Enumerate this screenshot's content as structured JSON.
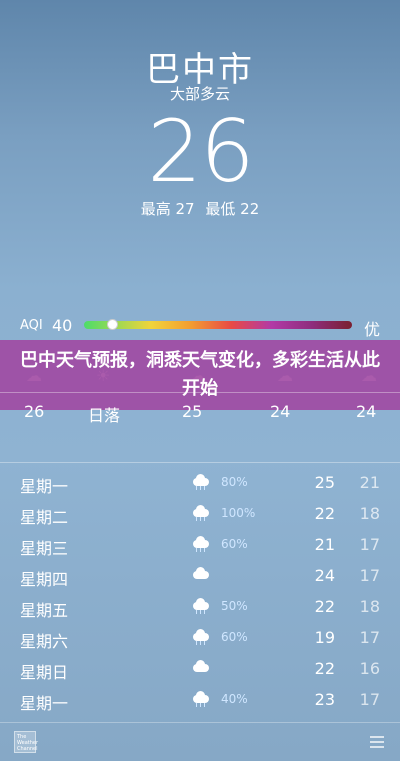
{
  "location": {
    "city": "巴中市",
    "condition": "大部多云",
    "current_temp": "26",
    "high_label": "最高 27",
    "low_label": "最低 22"
  },
  "aqi": {
    "label": "AQI",
    "value": "40",
    "level_word": "优",
    "level_fraction": 0.1
  },
  "banner": {
    "text": "巴中天气预报，洞悉天气变化，多彩生活从此开始"
  },
  "hourly": {
    "current_label": "26",
    "sunset_label": "日落",
    "temps": [
      "25",
      "24",
      "24"
    ],
    "icons": [
      "cloud-moon-icon",
      "sunset-icon",
      "cloud-moon-icon",
      "cloud-moon-icon",
      "cloud-moon-icon"
    ]
  },
  "forecast": [
    {
      "day": "星期一",
      "icon": "rain-cloud-icon",
      "precip": "80%",
      "high": "25",
      "low": "21"
    },
    {
      "day": "星期二",
      "icon": "rain-cloud-icon",
      "precip": "100%",
      "high": "22",
      "low": "18"
    },
    {
      "day": "星期三",
      "icon": "rain-cloud-icon",
      "precip": "60%",
      "high": "21",
      "low": "17"
    },
    {
      "day": "星期四",
      "icon": "cloud-icon",
      "precip": "",
      "high": "24",
      "low": "17"
    },
    {
      "day": "星期五",
      "icon": "rain-cloud-icon",
      "precip": "50%",
      "high": "22",
      "low": "18"
    },
    {
      "day": "星期六",
      "icon": "rain-cloud-icon",
      "precip": "60%",
      "high": "19",
      "low": "17"
    },
    {
      "day": "星期日",
      "icon": "cloud-icon",
      "precip": "",
      "high": "22",
      "low": "16"
    },
    {
      "day": "星期一",
      "icon": "rain-cloud-icon",
      "precip": "40%",
      "high": "23",
      "low": "17"
    }
  ],
  "footer": {
    "logo_text": "The Weather Channel"
  }
}
